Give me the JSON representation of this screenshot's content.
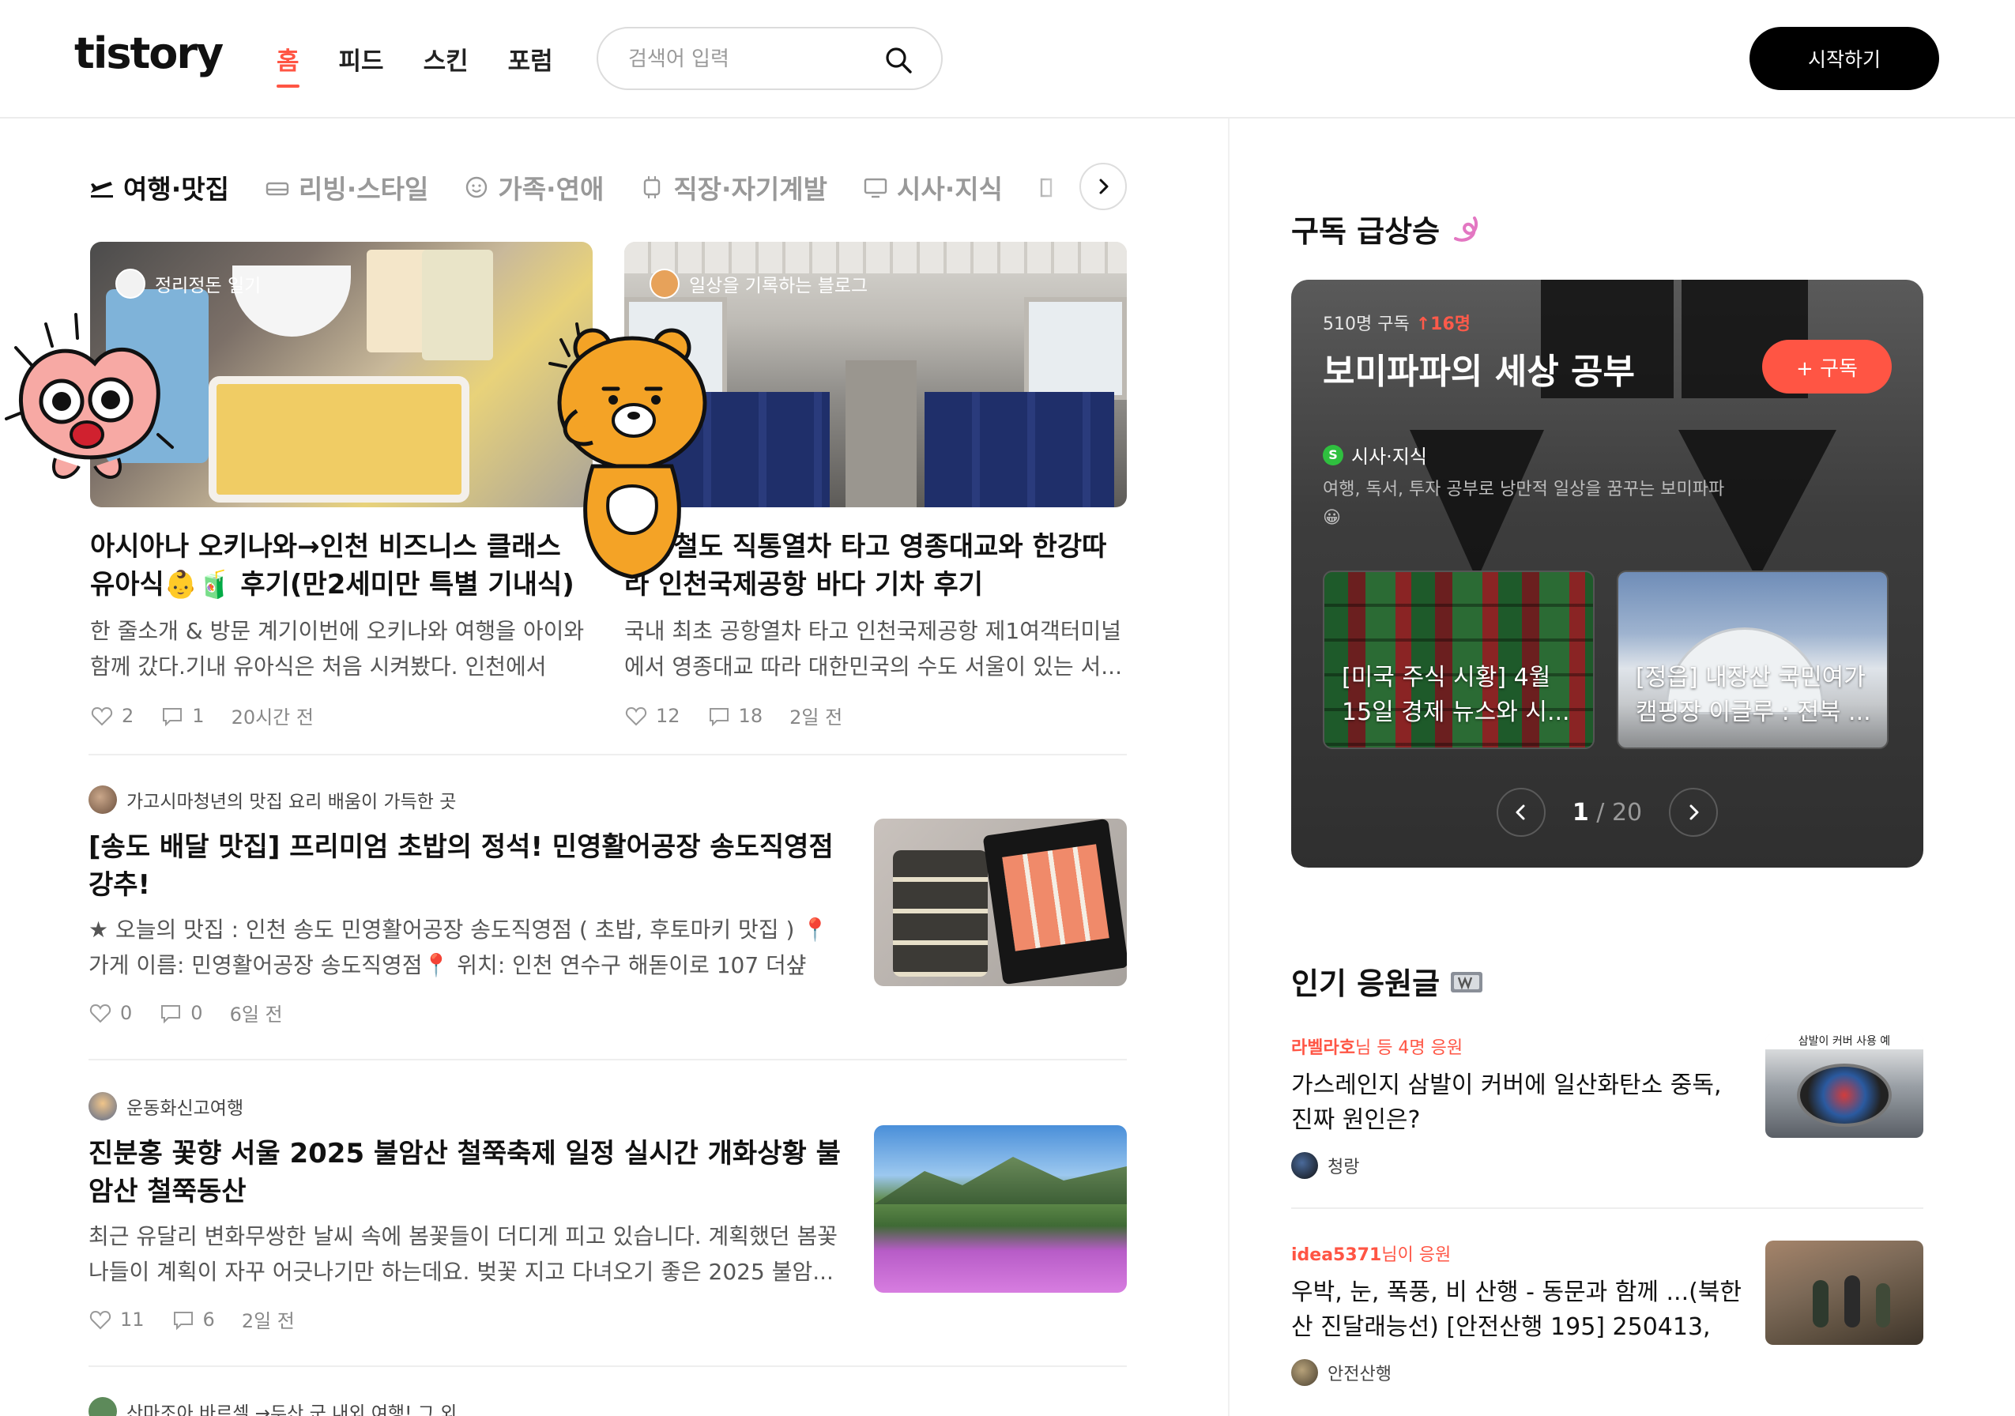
{
  "header": {
    "logo": "tistory",
    "nav": [
      "홈",
      "피드",
      "스킨",
      "포럼"
    ],
    "search_placeholder": "검색어 입력",
    "start_label": "시작하기"
  },
  "categories": [
    "여행·맛집",
    "리빙·스타일",
    "가족·연애",
    "직장·자기계발",
    "시사·지식"
  ],
  "cards": [
    {
      "blog": "정리정돈 일기",
      "title": "아시아나 오키나와→인천 비즈니스 클래스 유아식👶🧃 후기(만2세미만 특별 기내식)",
      "desc": "한 줄소개 & 방문 계기이번에 오키나와 여행을 아이와 함께 갔다.기내 유아식은 처음 시켜봤다. 인천에서 오...",
      "likes": "2",
      "comments": "1",
      "time": "20시간 전"
    },
    {
      "blog": "일상을 기록하는 블로그",
      "title": "공항철도 직통열차 타고 영종대교와 한강따라 인천국제공항 바다 기차 후기",
      "desc": "국내 최초 공항열차 타고 인천국제공항 제1여객터미널에서 영종대교 따라 대한민국의 수도 서울이 있는 서...",
      "likes": "12",
      "comments": "18",
      "time": "2일 전"
    }
  ],
  "list": [
    {
      "blog": "가고시마청년의 맛집 요리 배움이 가득한 곳",
      "title": "[송도 배달 맛집] 프리미엄 초밥의 정석! 민영활어공장 송도직영점 강추!",
      "desc": "★ 오늘의 맛집 : 인천 송도 민영활어공장 송도직영점 ( 초밥, 후토마키 맛집 ) 📍 가게 이름: 민영활어공장 송도직영점📍 위치: 인천 연수구 해돋이로 107 더샾 퍼...",
      "likes": "0",
      "comments": "0",
      "time": "6일 전"
    },
    {
      "blog": "운동화신고여행",
      "title": "진분홍 꽃향 서울 2025 불암산 철쭉축제 일정 실시간 개화상황 불암산 철쭉동산",
      "desc": "최근 유달리 변화무쌍한 날씨 속에 봄꽃들이 더디게 피고 있습니다. 계획했던 봄꽃 나들이 계획이 자꾸 어긋나기만 하는데요. 벚꽃 지고 다녀오기 좋은 2025 불암...",
      "likes": "11",
      "comments": "6",
      "time": "2일 전"
    },
    {
      "blog": "산마조아 바르셀 →두산 군 내외 여행! 그 외"
    }
  ],
  "subscribe": {
    "section_title": "구독 급상승",
    "count": "510명 구독",
    "increase": "↑16명",
    "blog_name": "보미파파의 세상 공부",
    "button": "+ 구독",
    "category_badge": "S",
    "category": "시사·지식",
    "desc": "여행, 독서, 투자 공부로 낭만적 일상을 꿈꾸는 보미파파😀",
    "posts": [
      {
        "title": "[미국 주식 시황] 4월 15일 경제 뉴스와 시..."
      },
      {
        "title": "[정읍] 내장산 국민여가 캠핑장 이글루 : 전북 ..."
      }
    ],
    "pager": {
      "current": "1",
      "total": "/ 20"
    }
  },
  "popular": {
    "section_title": "인기 응원글",
    "items": [
      {
        "supporter": "라벨라호",
        "support_text": "님 등 4명 응원",
        "title": "가스레인지 삼발이 커버에 일산화탄소 중독, 진짜 원인은?",
        "blog": "청랑",
        "thumb_caption": "삼발이 커버 사용 예"
      },
      {
        "supporter": "idea5371",
        "support_text": "님이 응원",
        "title": "우박, 눈, 폭풍, 비 산행 - 동문과 함께 ...(북한산 진달래능선) [안전산행 195] 250413, 나...",
        "blog": "안전산행"
      }
    ]
  },
  "colors": {
    "accent": "#ff5544",
    "dark": "#111111"
  }
}
